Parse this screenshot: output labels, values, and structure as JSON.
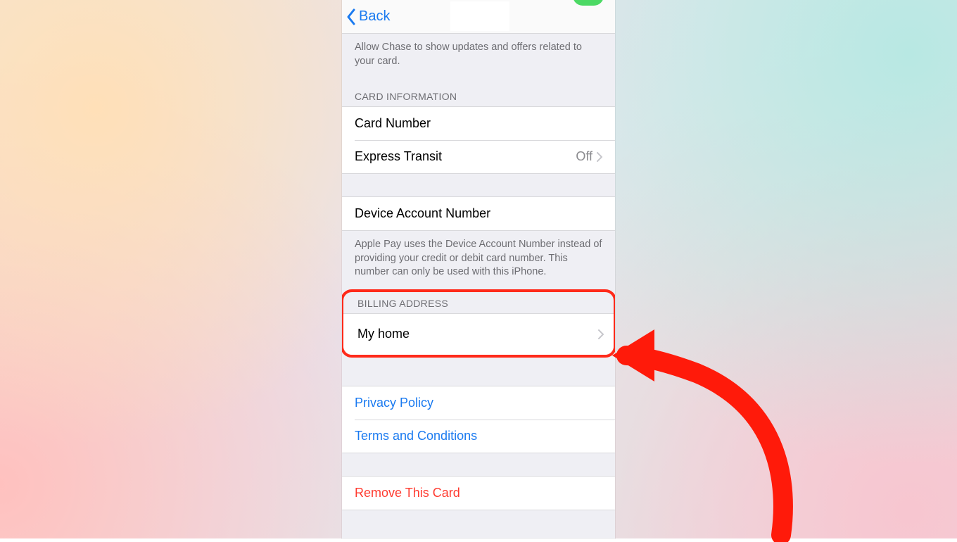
{
  "nav": {
    "back": "Back"
  },
  "sections": {
    "chase_footer": "Allow Chase to show updates and offers related to your card.",
    "card_info_header": "CARD INFORMATION",
    "card_number_label": "Card Number",
    "express_transit_label": "Express Transit",
    "express_transit_value": "Off",
    "device_account_label": "Device Account Number",
    "device_account_footer": "Apple Pay uses the Device Account Number instead of providing your credit or debit card number. This number can only be used with this iPhone.",
    "billing_header": "BILLING ADDRESS",
    "billing_value": "My home",
    "privacy": "Privacy Policy",
    "terms": "Terms and Conditions",
    "remove": "Remove This Card"
  }
}
